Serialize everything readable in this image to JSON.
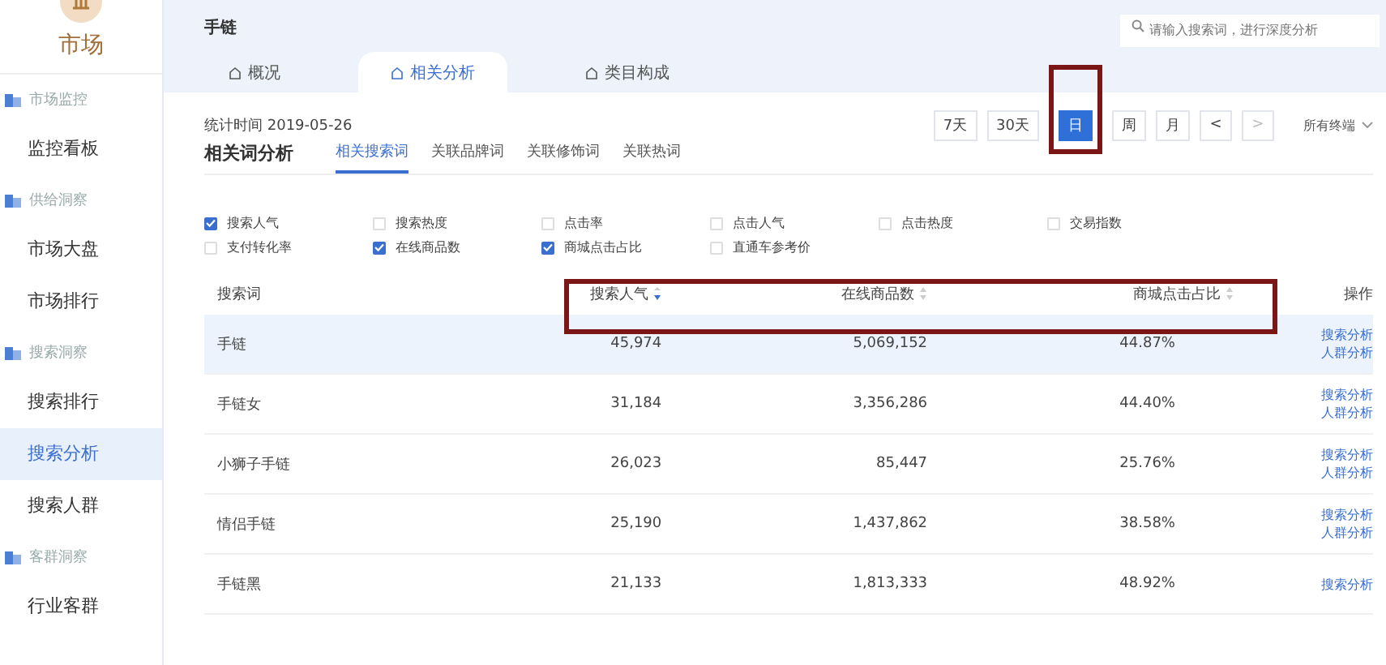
{
  "sidebar": {
    "logo_label": "市场",
    "groups": [
      {
        "label": "市场监控",
        "children": [
          {
            "label": "监控看板",
            "selected": false
          }
        ]
      },
      {
        "label": "供给洞察",
        "children": [
          {
            "label": "市场大盘",
            "selected": false
          },
          {
            "label": "市场排行",
            "selected": false
          }
        ]
      },
      {
        "label": "搜索洞察",
        "children": [
          {
            "label": "搜索排行",
            "selected": false
          },
          {
            "label": "搜索分析",
            "selected": true
          },
          {
            "label": "搜索人群",
            "selected": false
          }
        ]
      },
      {
        "label": "客群洞察",
        "children": [
          {
            "label": "行业客群",
            "selected": false
          }
        ]
      }
    ]
  },
  "header": {
    "title": "手链",
    "search": {
      "placeholder": "请输入搜索词，进行深度分析"
    },
    "tabs": [
      {
        "label": "概况",
        "selected": false
      },
      {
        "label": "相关分析",
        "selected": true
      },
      {
        "label": "类目构成",
        "selected": false
      }
    ]
  },
  "panel": {
    "stat_time": "统计时间 2019-05-26",
    "periods": [
      {
        "label": "7天",
        "selected": false
      },
      {
        "label": "30天",
        "selected": false
      },
      {
        "label": "日",
        "selected": true
      },
      {
        "label": "周",
        "selected": false
      },
      {
        "label": "月",
        "selected": false
      }
    ],
    "prev": "<",
    "next": ">",
    "device": "所有终端",
    "section_title": "相关词分析",
    "subtabs": [
      {
        "label": "相关搜索词",
        "selected": true
      },
      {
        "label": "关联品牌词",
        "selected": false
      },
      {
        "label": "关联修饰词",
        "selected": false
      },
      {
        "label": "关联热词",
        "selected": false
      }
    ],
    "metrics": [
      {
        "label": "搜索人气",
        "checked": true
      },
      {
        "label": "搜索热度",
        "checked": false
      },
      {
        "label": "点击率",
        "checked": false
      },
      {
        "label": "点击人气",
        "checked": false
      },
      {
        "label": "点击热度",
        "checked": false
      },
      {
        "label": "交易指数",
        "checked": false
      },
      {
        "label": "支付转化率",
        "checked": false
      },
      {
        "label": "在线商品数",
        "checked": true
      },
      {
        "label": "商城点击占比",
        "checked": true
      },
      {
        "label": "直通车参考价",
        "checked": false
      }
    ],
    "table": {
      "columns": [
        {
          "label": "搜索词",
          "sortable": false
        },
        {
          "label": "搜索人气",
          "sortable": true,
          "sorted": true
        },
        {
          "label": "在线商品数",
          "sortable": true,
          "sorted": false
        },
        {
          "label": "商城点击占比",
          "sortable": true,
          "sorted": false
        },
        {
          "label": "操作",
          "sortable": false
        }
      ],
      "rows": [
        {
          "selected": true,
          "cells": [
            "手链",
            "45,974",
            "5,069,152",
            "44.87%"
          ],
          "actions": [
            "搜索分析",
            "人群分析"
          ]
        },
        {
          "selected": false,
          "cells": [
            "手链女",
            "31,184",
            "3,356,286",
            "44.40%"
          ],
          "actions": [
            "搜索分析",
            "人群分析"
          ]
        },
        {
          "selected": false,
          "cells": [
            "小狮子手链",
            "26,023",
            "85,447",
            "25.76%"
          ],
          "actions": [
            "搜索分析",
            "人群分析"
          ]
        },
        {
          "selected": false,
          "cells": [
            "情侣手链",
            "25,190",
            "1,437,862",
            "38.58%"
          ],
          "actions": [
            "搜索分析",
            "人群分析"
          ]
        },
        {
          "selected": false,
          "cells": [
            "手链黑",
            "21,133",
            "1,813,333",
            "48.92%"
          ],
          "actions": [
            "搜索分析"
          ]
        }
      ]
    }
  }
}
